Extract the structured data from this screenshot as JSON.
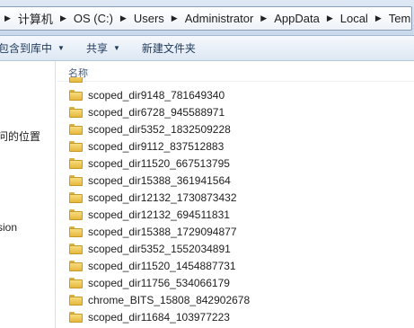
{
  "address": {
    "crumbs": [
      "计算机",
      "OS (C:)",
      "Users",
      "Administrator",
      "AppData",
      "Local",
      "Temp"
    ]
  },
  "toolbar": {
    "include_label": "包含到库中",
    "share_label": "共享",
    "new_folder_label": "新建文件夹"
  },
  "nav": {
    "items": [
      "问的位置",
      "sion"
    ]
  },
  "filelist": {
    "column_name": "名称",
    "items": [
      "scoped_dir9148_781649340",
      "scoped_dir6728_945588971",
      "scoped_dir5352_1832509228",
      "scoped_dir9112_837512883",
      "scoped_dir11520_667513795",
      "scoped_dir15388_361941564",
      "scoped_dir12132_1730873432",
      "scoped_dir12132_694511831",
      "scoped_dir15388_1729094877",
      "scoped_dir5352_1552034891",
      "scoped_dir11520_1454887731",
      "scoped_dir11756_534066179",
      "chrome_BITS_15808_842902678",
      "scoped_dir11684_103977223"
    ]
  }
}
